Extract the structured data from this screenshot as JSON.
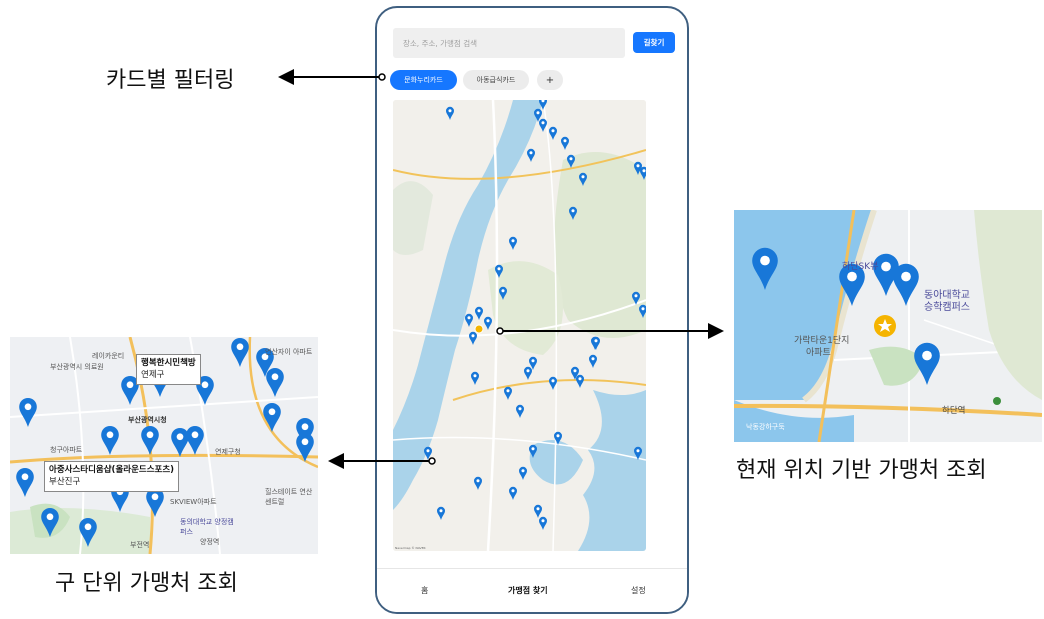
{
  "phone": {
    "search_placeholder": "장소, 주소, 가맹점 검색",
    "route_button": "길찾기",
    "filter_chips": {
      "culture_card": "문화누리카드",
      "child_meal_card": "아동급식카드",
      "add": "+"
    },
    "map_copyright": "Navermap © NAVER",
    "bottom_nav": {
      "home": "홈",
      "find_store": "가맹점 찾기",
      "settings": "설정"
    }
  },
  "callouts": {
    "card_filtering": "카드별 필터링",
    "location_based": "현재 위치 기반 가맹처 조회",
    "district_based": "구 단위 가맹처 조회"
  },
  "zoom_left": {
    "store_1": {
      "name": "행복한시민책방",
      "district": "연제구"
    },
    "store_2": {
      "name": "아중사스타디움샵(올라운드스포츠)",
      "district": "부산진구"
    },
    "map_labels": {
      "city_hall": "부산광역시청",
      "metro_a": "부산광역시 의료원",
      "raon": "레이카운티",
      "yeonsan": "연산자이 아파트",
      "dong_eui": "동의대학교 양정캠퍼스",
      "yangjeong": "양정역",
      "skview": "SKVIEW아파트",
      "hills": "힐스테이트 연산센트럴",
      "yeonje": "연제구청",
      "cheonggu": "청구아파트",
      "bujeon_station": "부전역"
    },
    "colors": {
      "pin": "#1877d8",
      "road": "#f3c05b"
    }
  },
  "zoom_right": {
    "campus_label": [
      "하단SK뷰",
      "동아대학교",
      "승학캠퍼스"
    ],
    "apartment_label": [
      "가락타운1단지",
      "아파트"
    ],
    "station_label": "하단역",
    "river_label": "낙동강하구둑",
    "colors": {
      "pin": "#1877d8",
      "current_location": "#f5b400",
      "river": "#8cc6ec"
    }
  }
}
